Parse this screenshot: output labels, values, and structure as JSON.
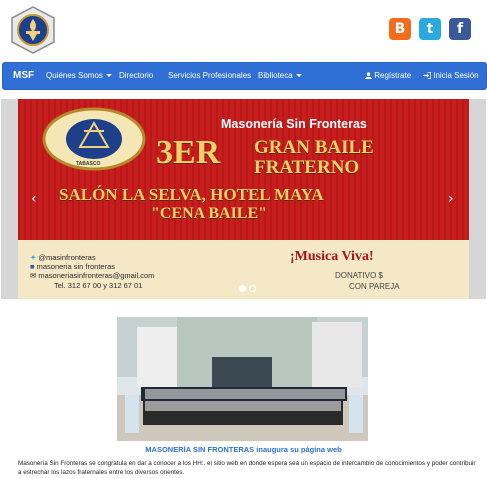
{
  "brand": "MSF",
  "nav": {
    "quienes": "Quiénes Somos",
    "directorio": "Directorio",
    "servicios": "Servicios Profesionales",
    "biblioteca": "Biblioteca",
    "registrate": "Regístrate",
    "inicia_sesion": "Inicia Sesión"
  },
  "social": {
    "blogger": "B",
    "twitter": "t",
    "facebook": "f"
  },
  "banner": {
    "title": "Masonería Sin Fronteras",
    "event_num": "3ER",
    "event_line1": "GRAN BAILE",
    "event_line2": "FRATERNO",
    "venue": "SALÓN LA SELVA, HOTEL MAYA",
    "dinner": "\"CENA BAILE\"",
    "twitter": "@masinfronteras",
    "facebook": "masoneria sin fronteras",
    "email": "masoneriasinfronteras@gmail.com",
    "phone": "Tel. 312 67 00 y 312 67 01",
    "music": "¡Musica Viva!",
    "donation": "DONATIVO $",
    "couple": "CON PAREJA",
    "seal_text": "TABASCO"
  },
  "caption": "MASONERÍA SIN FRONTERAS inaugura su página web",
  "article": "Masonería Sin Fronteras se congratula en dar a conocer a los HH:. el sitio web en donde espera sea un espacio de intercambio de conocimientos y poder contribuir a estrechar los lazos fraternales entre los diversos orientes.",
  "colors": {
    "navbar": "#2f6fd6",
    "caption": "#2f6fd6",
    "banner_red": "#c91d1d"
  }
}
